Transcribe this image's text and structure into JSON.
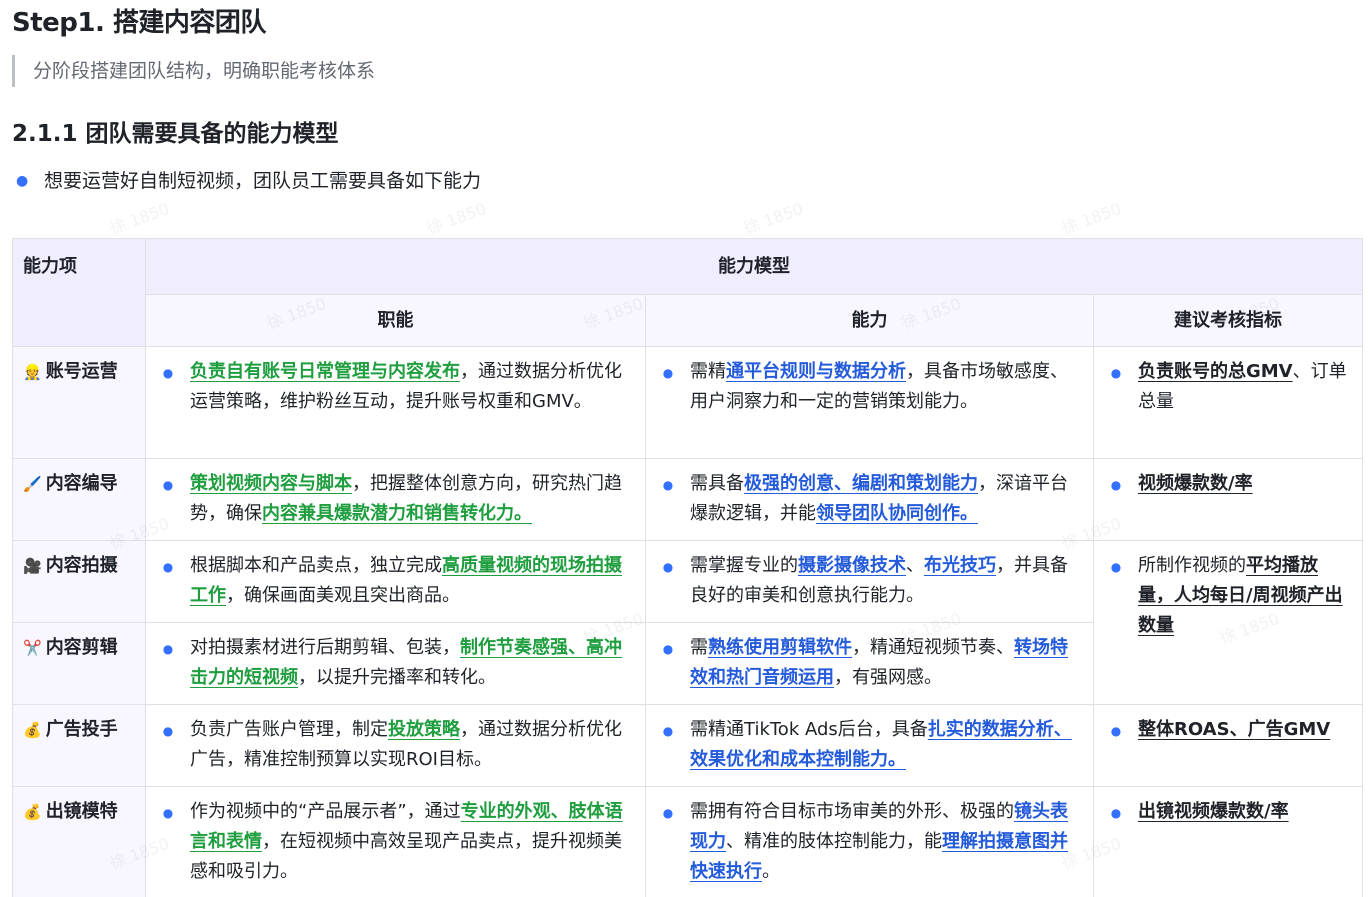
{
  "title": "Step1. 搭建内容团队",
  "quote": "分阶段搭建团队结构，明确职能考核体系",
  "section_heading": "2.1.1 团队需要具备的能力模型",
  "intro": "想要运营好自制短视频，团队员工需要具备如下能力",
  "watermark": "徐 1850",
  "table": {
    "col_first": "能力项",
    "col_group": "能力模型",
    "col_duty": "职能",
    "col_ability": "能力",
    "col_kpi": "建议考核指标",
    "rows": [
      {
        "emoji": "👷",
        "label": "账号运营",
        "duty": [
          {
            "t": "负责自有账号日常管理与内容发布",
            "s": "g"
          },
          {
            "t": "，通过数据分析优化运营策略，维护粉丝互动，提升账号权重和GMV。"
          }
        ],
        "ability": [
          {
            "t": "需精"
          },
          {
            "t": "通平台规则与数据分析",
            "s": "b"
          },
          {
            "t": "，具备市场敏感度、用户洞察力和一定的营销策划能力。"
          }
        ],
        "kpi": [
          {
            "t": "负责账号的总GMV",
            "s": "k"
          },
          {
            "t": "、订单总量"
          }
        ]
      },
      {
        "emoji": "🖌️",
        "label": "内容编导",
        "duty": [
          {
            "t": "策划视频内容与脚本",
            "s": "g"
          },
          {
            "t": "，把握整体创意方向，研究热门趋势，确保"
          },
          {
            "t": "内容兼具爆款潜力和销售转化力。",
            "s": "g"
          }
        ],
        "ability": [
          {
            "t": "需具备"
          },
          {
            "t": "极强的创意、编剧和策划能力",
            "s": "b"
          },
          {
            "t": "，深谙平台爆款逻辑，并能"
          },
          {
            "t": "领导团队协同创作。",
            "s": "b"
          }
        ],
        "kpi": [
          {
            "t": "视频爆款数/率",
            "s": "k"
          }
        ]
      },
      {
        "emoji": "🎥",
        "label": "内容拍摄",
        "duty": [
          {
            "t": "根据脚本和产品卖点，独立完成"
          },
          {
            "t": "高质量视频的现场拍摄工作",
            "s": "g"
          },
          {
            "t": "，确保画面美观且突出商品。"
          }
        ],
        "ability": [
          {
            "t": "需掌握专业的"
          },
          {
            "t": "摄影摄像技术",
            "s": "b"
          },
          {
            "t": "、"
          },
          {
            "t": "布光技巧",
            "s": "b"
          },
          {
            "t": "，并具备良好的审美和创意执行能力。"
          }
        ],
        "kpi": [
          {
            "t": "所制作视频的"
          },
          {
            "t": "平均播放量，人均每日/周视频产出数量",
            "s": "k"
          }
        ]
      },
      {
        "emoji": "✂️",
        "label": "内容剪辑",
        "duty": [
          {
            "t": "对拍摄素材进行后期剪辑、包装，"
          },
          {
            "t": "制作节奏感强、高冲击力的短视频",
            "s": "g"
          },
          {
            "t": "，以提升完播率和转化。"
          }
        ],
        "ability": [
          {
            "t": "需"
          },
          {
            "t": "熟练使用剪辑软件",
            "s": "b"
          },
          {
            "t": "，精通短视频节奏、"
          },
          {
            "t": "转场特效和热门音频运用",
            "s": "b"
          },
          {
            "t": "，有强网感。"
          }
        ],
        "kpi": []
      },
      {
        "emoji": "💰",
        "label": "广告投手",
        "duty": [
          {
            "t": "负责广告账户管理，制定"
          },
          {
            "t": "投放策略",
            "s": "g"
          },
          {
            "t": "，通过数据分析优化广告，精准控制预算以实现ROI目标。"
          }
        ],
        "ability": [
          {
            "t": "需精通TikTok Ads后台，具备"
          },
          {
            "t": "扎实的数据分析、效果优化和成本控制能力。",
            "s": "b"
          }
        ],
        "kpi": [
          {
            "t": "整体ROAS、广告GMV",
            "s": "k"
          }
        ]
      },
      {
        "emoji": "💰",
        "label": "出镜模特",
        "duty": [
          {
            "t": "作为视频中的“产品展示者”，通过"
          },
          {
            "t": "专业的外观、肢体语言和表情",
            "s": "g"
          },
          {
            "t": "，在短视频中高效呈现产品卖点，提升视频美感和吸引力。"
          }
        ],
        "ability": [
          {
            "t": "需拥有符合目标市场审美的外形、极强的"
          },
          {
            "t": "镜头表现力",
            "s": "b"
          },
          {
            "t": "、精准的肢体控制能力，能"
          },
          {
            "t": "理解拍摄意图并快速执行",
            "s": "b"
          },
          {
            "t": "。"
          }
        ],
        "kpi": [
          {
            "t": "出镜视频爆款数/率",
            "s": "k"
          }
        ]
      }
    ]
  }
}
